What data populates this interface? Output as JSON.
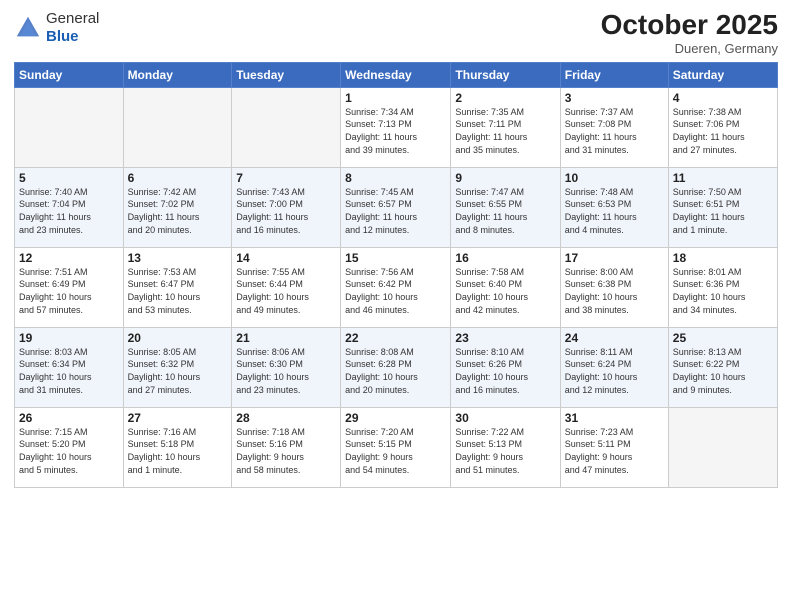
{
  "header": {
    "logo_line1": "General",
    "logo_line2": "Blue",
    "month": "October 2025",
    "location": "Dueren, Germany"
  },
  "weekdays": [
    "Sunday",
    "Monday",
    "Tuesday",
    "Wednesday",
    "Thursday",
    "Friday",
    "Saturday"
  ],
  "weeks": [
    [
      {
        "day": "",
        "info": ""
      },
      {
        "day": "",
        "info": ""
      },
      {
        "day": "",
        "info": ""
      },
      {
        "day": "1",
        "info": "Sunrise: 7:34 AM\nSunset: 7:13 PM\nDaylight: 11 hours\nand 39 minutes."
      },
      {
        "day": "2",
        "info": "Sunrise: 7:35 AM\nSunset: 7:11 PM\nDaylight: 11 hours\nand 35 minutes."
      },
      {
        "day": "3",
        "info": "Sunrise: 7:37 AM\nSunset: 7:08 PM\nDaylight: 11 hours\nand 31 minutes."
      },
      {
        "day": "4",
        "info": "Sunrise: 7:38 AM\nSunset: 7:06 PM\nDaylight: 11 hours\nand 27 minutes."
      }
    ],
    [
      {
        "day": "5",
        "info": "Sunrise: 7:40 AM\nSunset: 7:04 PM\nDaylight: 11 hours\nand 23 minutes."
      },
      {
        "day": "6",
        "info": "Sunrise: 7:42 AM\nSunset: 7:02 PM\nDaylight: 11 hours\nand 20 minutes."
      },
      {
        "day": "7",
        "info": "Sunrise: 7:43 AM\nSunset: 7:00 PM\nDaylight: 11 hours\nand 16 minutes."
      },
      {
        "day": "8",
        "info": "Sunrise: 7:45 AM\nSunset: 6:57 PM\nDaylight: 11 hours\nand 12 minutes."
      },
      {
        "day": "9",
        "info": "Sunrise: 7:47 AM\nSunset: 6:55 PM\nDaylight: 11 hours\nand 8 minutes."
      },
      {
        "day": "10",
        "info": "Sunrise: 7:48 AM\nSunset: 6:53 PM\nDaylight: 11 hours\nand 4 minutes."
      },
      {
        "day": "11",
        "info": "Sunrise: 7:50 AM\nSunset: 6:51 PM\nDaylight: 11 hours\nand 1 minute."
      }
    ],
    [
      {
        "day": "12",
        "info": "Sunrise: 7:51 AM\nSunset: 6:49 PM\nDaylight: 10 hours\nand 57 minutes."
      },
      {
        "day": "13",
        "info": "Sunrise: 7:53 AM\nSunset: 6:47 PM\nDaylight: 10 hours\nand 53 minutes."
      },
      {
        "day": "14",
        "info": "Sunrise: 7:55 AM\nSunset: 6:44 PM\nDaylight: 10 hours\nand 49 minutes."
      },
      {
        "day": "15",
        "info": "Sunrise: 7:56 AM\nSunset: 6:42 PM\nDaylight: 10 hours\nand 46 minutes."
      },
      {
        "day": "16",
        "info": "Sunrise: 7:58 AM\nSunset: 6:40 PM\nDaylight: 10 hours\nand 42 minutes."
      },
      {
        "day": "17",
        "info": "Sunrise: 8:00 AM\nSunset: 6:38 PM\nDaylight: 10 hours\nand 38 minutes."
      },
      {
        "day": "18",
        "info": "Sunrise: 8:01 AM\nSunset: 6:36 PM\nDaylight: 10 hours\nand 34 minutes."
      }
    ],
    [
      {
        "day": "19",
        "info": "Sunrise: 8:03 AM\nSunset: 6:34 PM\nDaylight: 10 hours\nand 31 minutes."
      },
      {
        "day": "20",
        "info": "Sunrise: 8:05 AM\nSunset: 6:32 PM\nDaylight: 10 hours\nand 27 minutes."
      },
      {
        "day": "21",
        "info": "Sunrise: 8:06 AM\nSunset: 6:30 PM\nDaylight: 10 hours\nand 23 minutes."
      },
      {
        "day": "22",
        "info": "Sunrise: 8:08 AM\nSunset: 6:28 PM\nDaylight: 10 hours\nand 20 minutes."
      },
      {
        "day": "23",
        "info": "Sunrise: 8:10 AM\nSunset: 6:26 PM\nDaylight: 10 hours\nand 16 minutes."
      },
      {
        "day": "24",
        "info": "Sunrise: 8:11 AM\nSunset: 6:24 PM\nDaylight: 10 hours\nand 12 minutes."
      },
      {
        "day": "25",
        "info": "Sunrise: 8:13 AM\nSunset: 6:22 PM\nDaylight: 10 hours\nand 9 minutes."
      }
    ],
    [
      {
        "day": "26",
        "info": "Sunrise: 7:15 AM\nSunset: 5:20 PM\nDaylight: 10 hours\nand 5 minutes."
      },
      {
        "day": "27",
        "info": "Sunrise: 7:16 AM\nSunset: 5:18 PM\nDaylight: 10 hours\nand 1 minute."
      },
      {
        "day": "28",
        "info": "Sunrise: 7:18 AM\nSunset: 5:16 PM\nDaylight: 9 hours\nand 58 minutes."
      },
      {
        "day": "29",
        "info": "Sunrise: 7:20 AM\nSunset: 5:15 PM\nDaylight: 9 hours\nand 54 minutes."
      },
      {
        "day": "30",
        "info": "Sunrise: 7:22 AM\nSunset: 5:13 PM\nDaylight: 9 hours\nand 51 minutes."
      },
      {
        "day": "31",
        "info": "Sunrise: 7:23 AM\nSunset: 5:11 PM\nDaylight: 9 hours\nand 47 minutes."
      },
      {
        "day": "",
        "info": ""
      }
    ]
  ]
}
